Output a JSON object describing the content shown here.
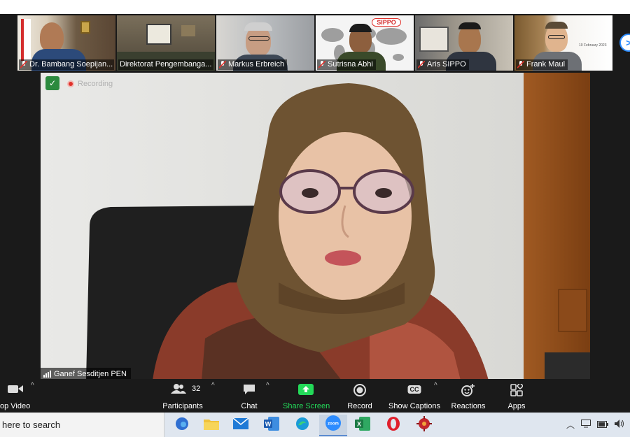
{
  "gallery": {
    "participants": [
      {
        "name": "Dr. Bambang Soepijan..."
      },
      {
        "name": "Direktorat Pengembanga..."
      },
      {
        "name": "Markus Erbreich"
      },
      {
        "name": "Sutrisna Abhi"
      },
      {
        "name": "Aris SIPPO"
      },
      {
        "name": "Frank Maul"
      }
    ],
    "next_arrow": ">"
  },
  "sippo_logo": "SIPPO",
  "slide_date": "10 February 2023",
  "recording_label": "Recording",
  "active_speaker": "Ganef Sesditjen PEN",
  "toolbar": {
    "stop_video": "op Video",
    "participants": "Participants",
    "participant_count": "32",
    "chat": "Chat",
    "share_screen": "Share Screen",
    "record": "Record",
    "show_captions": "Show Captions",
    "captions_icon": "CC",
    "reactions": "Reactions",
    "apps": "Apps"
  },
  "taskbar": {
    "search_text": "here to search",
    "apps": [
      "edge-chromium",
      "file-explorer",
      "mail",
      "word",
      "edge",
      "zoom",
      "excel",
      "opera",
      "game"
    ],
    "active_app": "zoom"
  },
  "colors": {
    "accent": "#2d8cff",
    "share_green": "#23d959",
    "record_red": "#e0312b"
  }
}
